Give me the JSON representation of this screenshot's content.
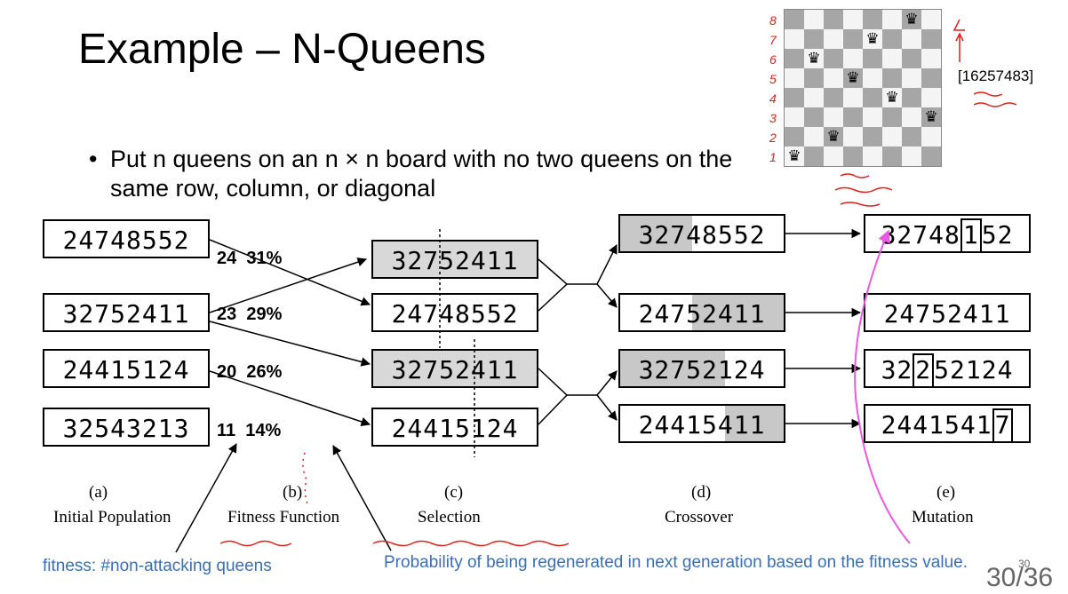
{
  "slide": {
    "title": "Example – N-Queens",
    "bullet": "Put n queens on an n × n board with no two queens on the same row, column, or diagonal",
    "page_number": "30/36",
    "page_number_sup": "30"
  },
  "board": {
    "size": 8,
    "row_labels": [
      "8",
      "7",
      "6",
      "5",
      "4",
      "3",
      "2",
      "1"
    ],
    "queens": [
      1,
      6,
      2,
      5,
      7,
      4,
      8,
      3
    ],
    "permutation": "[16257483]"
  },
  "columns": {
    "a": {
      "letter": "(a)",
      "caption": "Initial Population"
    },
    "b": {
      "letter": "(b)",
      "caption": "Fitness Function"
    },
    "c": {
      "letter": "(c)",
      "caption": "Selection"
    },
    "d": {
      "letter": "(d)",
      "caption": "Crossover"
    },
    "e": {
      "letter": "(e)",
      "caption": "Mutation"
    }
  },
  "initial_population": [
    "24748552",
    "32752411",
    "24415124",
    "32543213"
  ],
  "fitness": [
    {
      "score": "24",
      "percent": "31%"
    },
    {
      "score": "23",
      "percent": "29%"
    },
    {
      "score": "20",
      "percent": "26%"
    },
    {
      "score": "11",
      "percent": "14%"
    }
  ],
  "selection": [
    "32752411",
    "24748552",
    "32752411",
    "24415124"
  ],
  "crossover": [
    "32748552",
    "24752411",
    "32752124",
    "24415411"
  ],
  "mutation": [
    {
      "before": "32748",
      "mut": "1",
      "after": "52"
    },
    {
      "before": "24752411",
      "mut": "",
      "after": ""
    },
    {
      "before": "32",
      "mut": "2",
      "after": "52124"
    },
    {
      "before": "2441541",
      "mut": "7",
      "after": ""
    }
  ],
  "notes": {
    "fitness": "fitness: #non-attacking queens",
    "probability": "Probability of being regenerated in next generation based on the fitness value."
  },
  "colors": {
    "ink_red": "#e0201a",
    "ink_pink": "#e85ae0",
    "note_blue": "#3b6fb6",
    "shade": "#c8c8c8"
  }
}
